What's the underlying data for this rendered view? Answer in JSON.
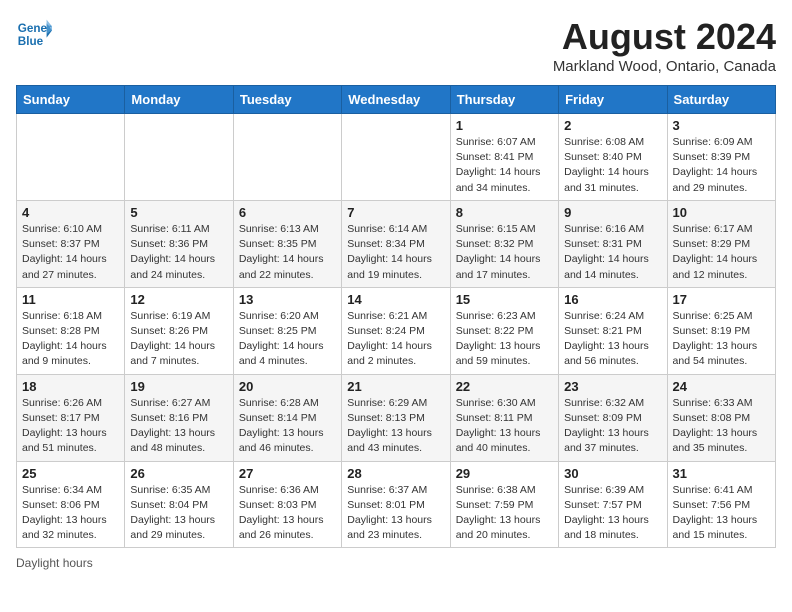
{
  "header": {
    "logo_line1": "General",
    "logo_line2": "Blue",
    "month_title": "August 2024",
    "location": "Markland Wood, Ontario, Canada"
  },
  "weekdays": [
    "Sunday",
    "Monday",
    "Tuesday",
    "Wednesday",
    "Thursday",
    "Friday",
    "Saturday"
  ],
  "weeks": [
    [
      {
        "day": "",
        "info": ""
      },
      {
        "day": "",
        "info": ""
      },
      {
        "day": "",
        "info": ""
      },
      {
        "day": "",
        "info": ""
      },
      {
        "day": "1",
        "info": "Sunrise: 6:07 AM\nSunset: 8:41 PM\nDaylight: 14 hours\nand 34 minutes."
      },
      {
        "day": "2",
        "info": "Sunrise: 6:08 AM\nSunset: 8:40 PM\nDaylight: 14 hours\nand 31 minutes."
      },
      {
        "day": "3",
        "info": "Sunrise: 6:09 AM\nSunset: 8:39 PM\nDaylight: 14 hours\nand 29 minutes."
      }
    ],
    [
      {
        "day": "4",
        "info": "Sunrise: 6:10 AM\nSunset: 8:37 PM\nDaylight: 14 hours\nand 27 minutes."
      },
      {
        "day": "5",
        "info": "Sunrise: 6:11 AM\nSunset: 8:36 PM\nDaylight: 14 hours\nand 24 minutes."
      },
      {
        "day": "6",
        "info": "Sunrise: 6:13 AM\nSunset: 8:35 PM\nDaylight: 14 hours\nand 22 minutes."
      },
      {
        "day": "7",
        "info": "Sunrise: 6:14 AM\nSunset: 8:34 PM\nDaylight: 14 hours\nand 19 minutes."
      },
      {
        "day": "8",
        "info": "Sunrise: 6:15 AM\nSunset: 8:32 PM\nDaylight: 14 hours\nand 17 minutes."
      },
      {
        "day": "9",
        "info": "Sunrise: 6:16 AM\nSunset: 8:31 PM\nDaylight: 14 hours\nand 14 minutes."
      },
      {
        "day": "10",
        "info": "Sunrise: 6:17 AM\nSunset: 8:29 PM\nDaylight: 14 hours\nand 12 minutes."
      }
    ],
    [
      {
        "day": "11",
        "info": "Sunrise: 6:18 AM\nSunset: 8:28 PM\nDaylight: 14 hours\nand 9 minutes."
      },
      {
        "day": "12",
        "info": "Sunrise: 6:19 AM\nSunset: 8:26 PM\nDaylight: 14 hours\nand 7 minutes."
      },
      {
        "day": "13",
        "info": "Sunrise: 6:20 AM\nSunset: 8:25 PM\nDaylight: 14 hours\nand 4 minutes."
      },
      {
        "day": "14",
        "info": "Sunrise: 6:21 AM\nSunset: 8:24 PM\nDaylight: 14 hours\nand 2 minutes."
      },
      {
        "day": "15",
        "info": "Sunrise: 6:23 AM\nSunset: 8:22 PM\nDaylight: 13 hours\nand 59 minutes."
      },
      {
        "day": "16",
        "info": "Sunrise: 6:24 AM\nSunset: 8:21 PM\nDaylight: 13 hours\nand 56 minutes."
      },
      {
        "day": "17",
        "info": "Sunrise: 6:25 AM\nSunset: 8:19 PM\nDaylight: 13 hours\nand 54 minutes."
      }
    ],
    [
      {
        "day": "18",
        "info": "Sunrise: 6:26 AM\nSunset: 8:17 PM\nDaylight: 13 hours\nand 51 minutes."
      },
      {
        "day": "19",
        "info": "Sunrise: 6:27 AM\nSunset: 8:16 PM\nDaylight: 13 hours\nand 48 minutes."
      },
      {
        "day": "20",
        "info": "Sunrise: 6:28 AM\nSunset: 8:14 PM\nDaylight: 13 hours\nand 46 minutes."
      },
      {
        "day": "21",
        "info": "Sunrise: 6:29 AM\nSunset: 8:13 PM\nDaylight: 13 hours\nand 43 minutes."
      },
      {
        "day": "22",
        "info": "Sunrise: 6:30 AM\nSunset: 8:11 PM\nDaylight: 13 hours\nand 40 minutes."
      },
      {
        "day": "23",
        "info": "Sunrise: 6:32 AM\nSunset: 8:09 PM\nDaylight: 13 hours\nand 37 minutes."
      },
      {
        "day": "24",
        "info": "Sunrise: 6:33 AM\nSunset: 8:08 PM\nDaylight: 13 hours\nand 35 minutes."
      }
    ],
    [
      {
        "day": "25",
        "info": "Sunrise: 6:34 AM\nSunset: 8:06 PM\nDaylight: 13 hours\nand 32 minutes."
      },
      {
        "day": "26",
        "info": "Sunrise: 6:35 AM\nSunset: 8:04 PM\nDaylight: 13 hours\nand 29 minutes."
      },
      {
        "day": "27",
        "info": "Sunrise: 6:36 AM\nSunset: 8:03 PM\nDaylight: 13 hours\nand 26 minutes."
      },
      {
        "day": "28",
        "info": "Sunrise: 6:37 AM\nSunset: 8:01 PM\nDaylight: 13 hours\nand 23 minutes."
      },
      {
        "day": "29",
        "info": "Sunrise: 6:38 AM\nSunset: 7:59 PM\nDaylight: 13 hours\nand 20 minutes."
      },
      {
        "day": "30",
        "info": "Sunrise: 6:39 AM\nSunset: 7:57 PM\nDaylight: 13 hours\nand 18 minutes."
      },
      {
        "day": "31",
        "info": "Sunrise: 6:41 AM\nSunset: 7:56 PM\nDaylight: 13 hours\nand 15 minutes."
      }
    ]
  ],
  "footer": {
    "daylight_label": "Daylight hours"
  }
}
